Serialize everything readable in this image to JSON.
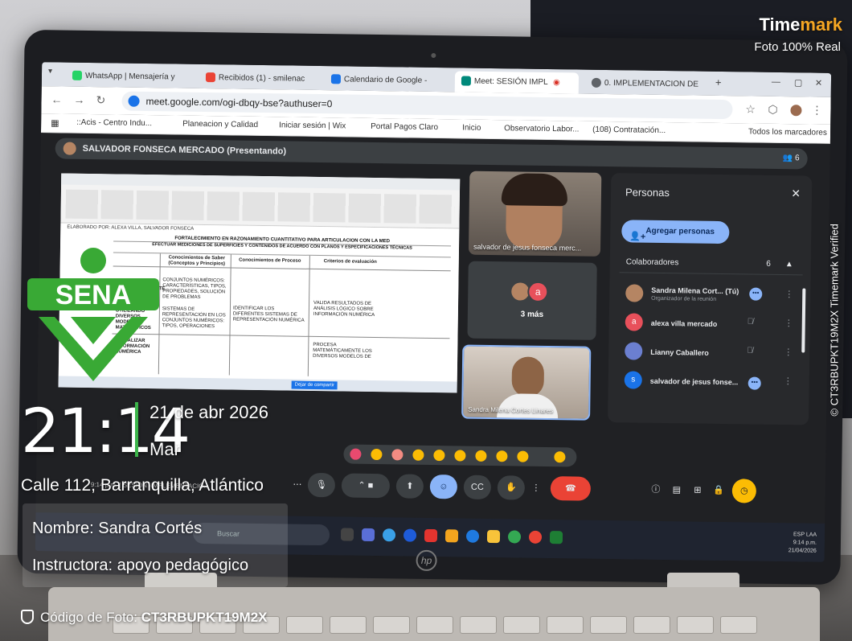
{
  "watermark": {
    "brand_prefix": "Time",
    "brand_suffix": "mark",
    "subtitle": "Foto 100% Real",
    "side_text": "© CT3RBUPKT19M2X  Timemark Verified",
    "accent_color": "#f5a623"
  },
  "stamp": {
    "logo_text": "SENA",
    "logo_color": "#39a935",
    "time": "21:14",
    "date": "21 de abr 2026",
    "weekday": "Mar",
    "location": "Calle 112, Barranquilla, Atlántico",
    "name_line": "Nombre: Sandra Cortés",
    "role_line": "Instructora:  apoyo pedagógico",
    "code_label": "Código de Foto: ",
    "code_value": "CT3RBUPKT19M2X"
  },
  "browser": {
    "tabs": [
      {
        "label": "WhatsApp | Mensajería y",
        "icon": "whatsapp-icon",
        "color": "#25d366"
      },
      {
        "label": "Recibidos (1) - smilenac",
        "icon": "gmail-icon",
        "color": "#ea4335"
      },
      {
        "label": "Calendario de Google -",
        "icon": "calendar-icon",
        "color": "#1a73e8"
      },
      {
        "label": "Meet: SESIÓN  IMPL",
        "icon": "meet-icon",
        "color": "#00897b"
      },
      {
        "label": "0. IMPLEMENTACION DE",
        "icon": "drive-icon",
        "color": "#5f6368"
      }
    ],
    "url": "meet.google.com/ogi-dbqy-bse?authuser=0",
    "bookmarks": [
      "::Acis - Centro Indu...",
      "Planeacion y Calidad",
      "Iniciar sesión | Wix",
      "Portal Pagos Claro",
      "Inicio",
      "Observatorio Labor...",
      "(108) Contratación...",
      "Todos los marcadores"
    ]
  },
  "meet": {
    "presenter": "SALVADOR FONSECA MERCADO (Presentando)",
    "participant_count": "6",
    "shared_sheet": {
      "title": "FORTALECIMIENTO EN RAZONAMIENTO CUANTITATIVO PARA ARTICULACION CON LA MED",
      "subtitle": "EFECTUAR MEDICIONES DE SUPERFICIES Y CONTENIDOS DE ACUERDO CON PLANOS Y ESPECIFICACIONES TÉCNICAS",
      "col_1": "Conocimientos de Saber (Conceptos y Principios)",
      "col_2": "Conocimientos de Proceso",
      "col_3": "Criterios de evaluación",
      "row_1": "1.REPRESENTAR MATEMÁTICAMENTE SITUACIONES CUANTIFICABLES EN CONTEXTO UTILIZANDO DIVERSOS MODELOS MATEMÁTICOS",
      "row_2": "2. ANALIZAR INFORMACIÓN NUMÉRICA",
      "cell_1": "CONJUNTOS NUMÉRICOS: CARACTERÍSTICAS, TIPOS, PROPIEDADES, SOLUCIÓN DE PROBLEMAS",
      "cell_2": "SISTEMAS DE REPRESENTACIÓN EN LOS CONJUNTOS NUMÉRICOS: TIPOS, OPERACIONES",
      "cell_3": "IDENTIFICAR LOS DIFERENTES SISTEMAS DE REPRESENTACIÓN NUMÉRICA",
      "cell_4": "VALIDA RESULTADOS DE ANÁLISIS LÓGICO SOBRE INFORMACIÓN NUMÉRICA",
      "cell_5": "PROCESA MATEMÁTICAMENTE LOS DIVERSOS MODELOS DE",
      "share_label": "Dejar de compartir",
      "elaborated": "ELABORADO POR: ALEXA VILLA, SALVADOR FONSECA"
    },
    "tiles": {
      "salvador": "salvador de jesus fonseca merc...",
      "more": "3 más",
      "more_initial": "a",
      "sandra": "Sandra Milena Cortes Linares"
    },
    "people_panel": {
      "title": "Personas",
      "add_label": "Agregar personas",
      "section": "Colaboradores",
      "section_count": "6",
      "people": [
        {
          "name": "Sandra Milena Cort... (Tú)",
          "role": "Organizador de la reunión",
          "initial": "",
          "color": "#b58563"
        },
        {
          "name": "alexa villa mercado",
          "role": "",
          "initial": "a",
          "color": "#e8505b"
        },
        {
          "name": "Lianny Caballero",
          "role": "",
          "initial": "",
          "color": "#6b7fd0"
        },
        {
          "name": "salvador de jesus fonse...",
          "role": "",
          "initial": "s",
          "color": "#1a73e8"
        }
      ]
    },
    "meeting_info": "9:14 p.m.  |  SESIÓN -IMPLEMENTACIÓ..."
  },
  "taskbar": {
    "search_placeholder": "Buscar",
    "tray_lang": "ESP LAA",
    "tray_time": "9:14 p.m.",
    "tray_date": "21/04/2026"
  }
}
